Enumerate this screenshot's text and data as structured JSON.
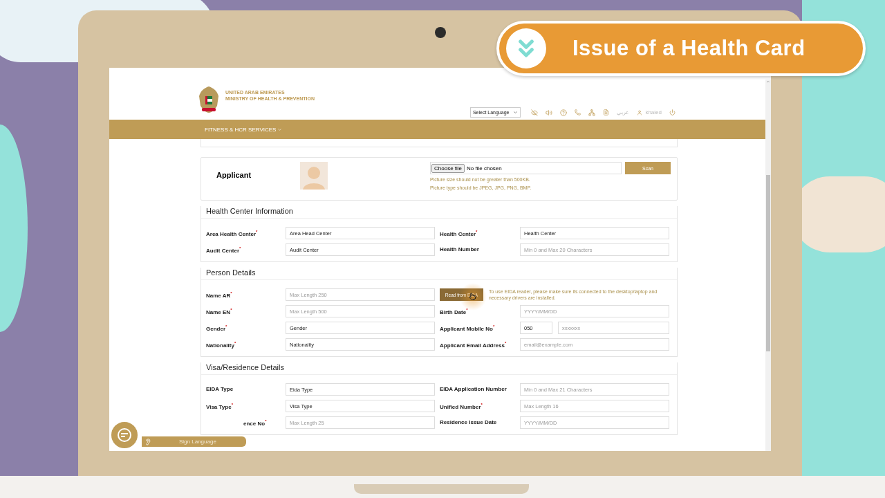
{
  "banner": {
    "title": "Issue of a Health Card"
  },
  "header": {
    "org_line_1": "UNITED ARAB EMIRATES",
    "org_line_2": "MINISTRY OF HEALTH & PREVENTION",
    "language_select": "Select Language",
    "arabic_link": "عربي",
    "user": "khaled"
  },
  "nav": {
    "menu": "FITNESS & HCR SERVICES"
  },
  "applicant": {
    "label": "Applicant",
    "file_button": "Choose file",
    "file_status": "No file chosen",
    "hints": [
      "Picture size should not be greater than 500KB.",
      "Picture type should be JPEG, JPG, PNG, BMP."
    ],
    "scan_button": "Scan"
  },
  "sections": [
    {
      "title": "Health Center Information",
      "rows": [
        [
          {
            "kind": "text",
            "label": "Area Health Center$^{*}$",
            "value": "Area Head Center"
          },
          {
            "kind": "text",
            "label": "Health Center$^{*}$",
            "value": "Health Center"
          }
        ],
        [
          {
            "kind": "text",
            "label": "Audit Center$^{*}$",
            "value": "Audit Center"
          },
          {
            "kind": "text",
            "label": "Health Number",
            "placeholder": "Min 0 and Max 20 Characters"
          }
        ]
      ]
    },
    {
      "title": "Person Details",
      "rows": [
        [
          {
            "kind": "text",
            "label": "Name AR$^{*}$",
            "placeholder": "Max Length 250"
          },
          {
            "kind": "eida",
            "button": "Read from EIDA",
            "note": "To use EIDA reader, please make sure its connected to the desktop/laptop and necessary drivers are installed."
          }
        ],
        [
          {
            "kind": "text",
            "label": "Name EN$^{*}$",
            "placeholder": "Max Length 500"
          },
          {
            "kind": "text",
            "label": "Birth Date$^{*}$",
            "placeholder": "YYYY/MM/DD"
          }
        ],
        [
          {
            "kind": "text",
            "label": "Gender$^{*}$",
            "value": "Gender"
          },
          {
            "kind": "phone",
            "label": "Applicant Mobile No$^{*}$",
            "value": "050",
            "placeholder": "xxxxxxx"
          }
        ],
        [
          {
            "kind": "text",
            "label": "Nationality$^{*}$",
            "value": "Nationality"
          },
          {
            "kind": "text",
            "label": "Applicant Email Address$^{*}$",
            "placeholder": "email@example.com"
          }
        ]
      ]
    },
    {
      "title": "Visa/Residence Details",
      "rows": [
        [
          {
            "kind": "text",
            "label": "EIDA Type",
            "value": "Eida Type"
          },
          {
            "kind": "text",
            "label": "EIDA Application Number",
            "placeholder": "Min 0 and Max 21 Characters"
          }
        ],
        [
          {
            "kind": "text",
            "label": "Visa Type$^{*}$",
            "value": "Visa Type"
          },
          {
            "kind": "text",
            "label": "Unified Number$^{*}$",
            "placeholder": "Max Length 16"
          }
        ],
        [
          {
            "kind": "text",
            "label": "ence No$^{*}$",
            "covered": true,
            "placeholder": "Max Length 25"
          },
          {
            "kind": "text",
            "label": "Residence Issue Date",
            "placeholder": "YYYY/MM/DD"
          }
        ]
      ]
    }
  ],
  "sign_language": {
    "label": "Sign Language"
  }
}
